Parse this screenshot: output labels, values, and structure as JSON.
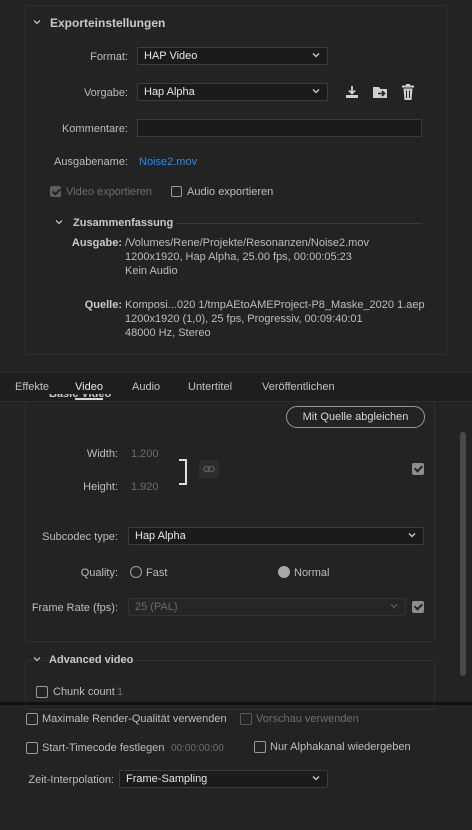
{
  "export_settings": {
    "section_title": "Exporteinstellungen",
    "format_label": "Format:",
    "format_value": "HAP Video",
    "preset_label": "Vorgabe:",
    "preset_value": "Hap Alpha",
    "comments_label": "Kommentare:",
    "comments_value": "",
    "output_name_label": "Ausgabename:",
    "output_name_value": "Noise2.mov",
    "export_video_label": "Video exportieren",
    "export_video_checked": true,
    "export_audio_label": "Audio exportieren",
    "export_audio_checked": false,
    "summary_title": "Zusammenfassung",
    "output_label": "Ausgabe:",
    "output_lines": [
      "/Volumes/Rene/Projekte/Resonanzen/Noise2.mov",
      "1200x1920, Hap Alpha, 25.00 fps, 00:00:05:23",
      "Kein Audio"
    ],
    "source_label": "Quelle:",
    "source_lines": [
      "Komposi...020 1/tmpAEtoAMEProject-P8_Maske_2020 1.aep",
      "1200x1920 (1,0), 25 fps, Progressiv, 00:09:40:01",
      "48000 Hz, Stereo"
    ]
  },
  "tabs": [
    "Effekte",
    "Video",
    "Audio",
    "Untertitel",
    "Veröffentlichen"
  ],
  "active_tab": "Video",
  "video": {
    "basic_video_title": "Basic Video",
    "match_source_button": "Mit Quelle abgleichen",
    "width_label": "Width:",
    "width_value": "1.200",
    "height_label": "Height:",
    "height_value": "1.920",
    "subcodec_label": "Subcodec type:",
    "subcodec_value": "Hap Alpha",
    "quality_label": "Quality:",
    "quality_fast": "Fast",
    "quality_normal": "Normal",
    "quality_selected": "Normal",
    "framerate_label": "Frame Rate (fps):",
    "framerate_value": "25 (PAL)",
    "advanced_title": "Advanced video",
    "chunk_count_label": "Chunk count",
    "chunk_count_value": "1"
  },
  "bottom": {
    "max_render_quality": "Maximale Render-Qualität verwenden",
    "use_preview": "Vorschau verwenden",
    "start_timecode": "Start-Timecode festlegen",
    "start_timecode_value": "00:00:00:00",
    "alpha_only": "Nur Alphakanal wiedergeben",
    "time_interp_label": "Zeit-Interpolation:",
    "time_interp_value": "Frame-Sampling"
  },
  "icons": {
    "save_preset": "save-preset-icon",
    "import_preset": "import-preset-icon",
    "delete_preset": "trash-icon",
    "link": "link-icon",
    "chevron": "chevron-down-icon"
  },
  "colors": {
    "link": "#2d8ceb",
    "background": "#232323"
  }
}
